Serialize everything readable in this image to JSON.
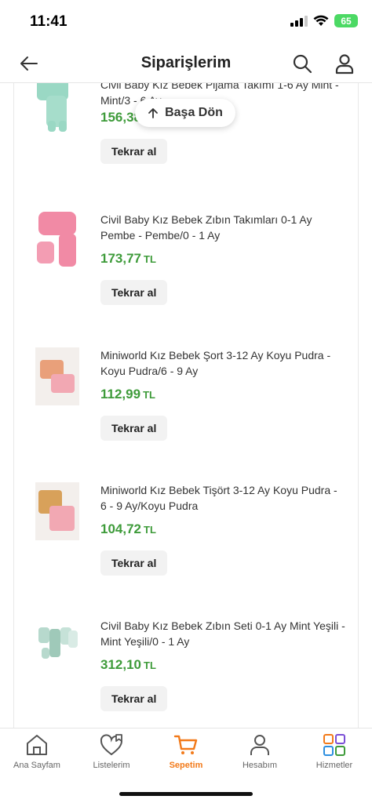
{
  "status": {
    "time": "11:41",
    "battery": "65"
  },
  "header": {
    "title": "Siparişlerim"
  },
  "back_to_top": {
    "label": "Başa Dön"
  },
  "colors": {
    "price_green": "#3e9b3a",
    "accent_orange": "#f27a1a"
  },
  "products": [
    {
      "name": "Civil Baby Kız Bebek Pijama Takımı 1-6 Ay Mint - Mint/3 - 6 Ay",
      "price": "156,38",
      "currency": "TL",
      "button": "Tekrar al"
    },
    {
      "name": "Civil Baby Kız Bebek Zıbın Takımları 0-1 Ay Pembe - Pembe/0 - 1 Ay",
      "price": "173,77",
      "currency": "TL",
      "button": "Tekrar al"
    },
    {
      "name": "Miniworld Kız Bebek Şort 3-12 Ay Koyu Pudra - Koyu Pudra/6 - 9 Ay",
      "price": "112,99",
      "currency": "TL",
      "button": "Tekrar al"
    },
    {
      "name": "Miniworld Kız Bebek Tişört 3-12 Ay Koyu Pudra - 6 - 9 Ay/Koyu Pudra",
      "price": "104,72",
      "currency": "TL",
      "button": "Tekrar al"
    },
    {
      "name": "Civil Baby Kız Bebek Zıbın Seti 0-1 Ay Mint Yeşili - Mint Yeşili/0 - 1 Ay",
      "price": "312,10",
      "currency": "TL",
      "button": "Tekrar al"
    }
  ],
  "nav": {
    "items": [
      {
        "label": "Ana Sayfam",
        "icon": "home-icon"
      },
      {
        "label": "Listelerim",
        "icon": "heart-list-icon"
      },
      {
        "label": "Sepetim",
        "icon": "cart-icon"
      },
      {
        "label": "Hesabım",
        "icon": "user-icon"
      },
      {
        "label": "Hizmetler",
        "icon": "grid-icon"
      }
    ]
  }
}
